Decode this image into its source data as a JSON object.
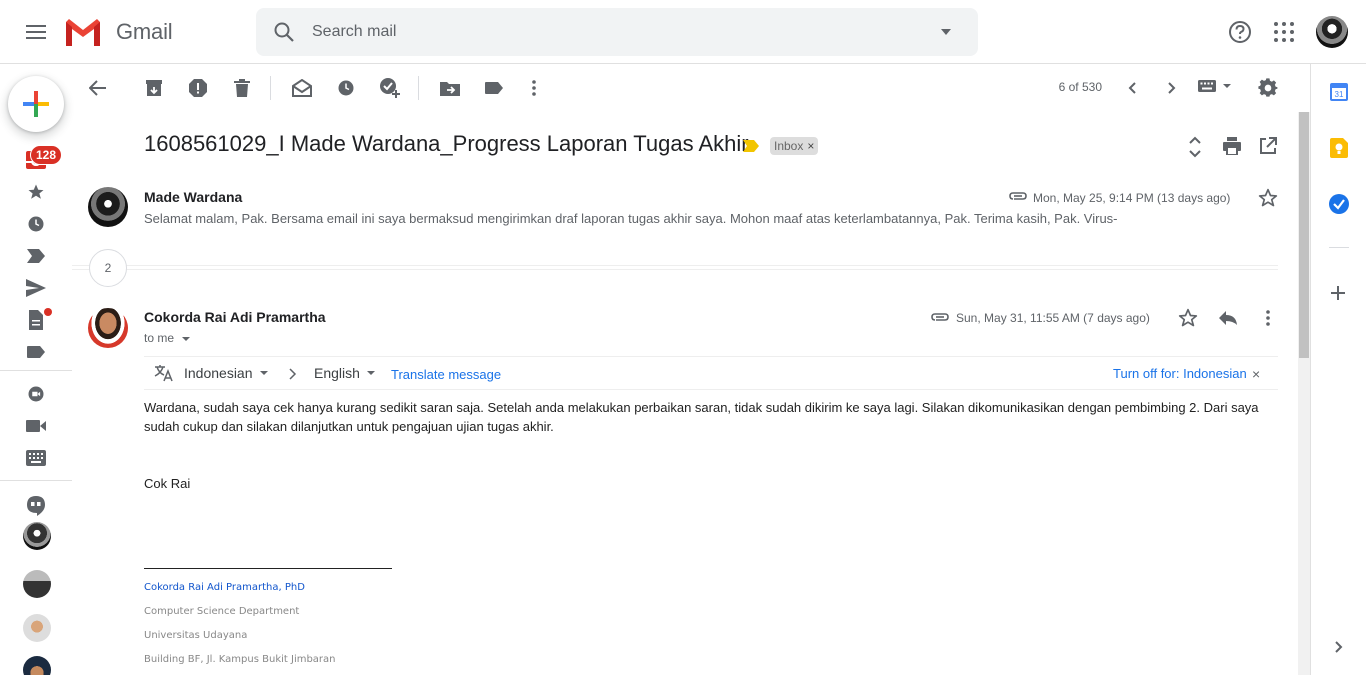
{
  "header": {
    "app_name": "Gmail",
    "search_placeholder": "Search mail"
  },
  "rail": {
    "inbox_badge": "128"
  },
  "toolbar": {
    "pager": "6 of 530"
  },
  "thread": {
    "subject": "1608561029_I Made Wardana_Progress Laporan Tugas Akhir",
    "label": "Inbox",
    "label_close": "×",
    "collapsed_count": "2"
  },
  "messages": [
    {
      "sender": "Made Wardana",
      "date": "Mon, May 25, 9:14 PM (13 days ago)",
      "snippet": "Selamat malam, Pak. Bersama email ini saya bermaksud mengirimkan draf laporan tugas akhir saya. Mohon maaf atas keterlambatannya, Pak. Terima kasih, Pak. Virus-"
    },
    {
      "sender": "Cokorda Rai Adi Pramartha",
      "date": "Sun, May 31, 11:55 AM (7 days ago)",
      "to": "to me",
      "body": "Wardana, sudah saya cek hanya kurang sedikit saran saja.  Setelah anda melakukan perbaikan saran, tidak sudah dikirim ke saya lagi.  Silakan dikomunikasikan dengan pembimbing 2.  Dari saya sudah cukup dan silakan dilanjutkan untuk pengajuan ujian tugas akhir.",
      "signoff": "Cok Rai",
      "signature": [
        "Cokorda Rai Adi Pramartha, PhD",
        "Computer Science Department",
        "Universitas Udayana",
        "Building BF, Jl. Kampus Bukit Jimbaran"
      ]
    }
  ],
  "translate": {
    "from": "Indonesian",
    "to": "English",
    "action": "Translate message",
    "turn_off": "Turn off for: Indonesian",
    "close": "×"
  },
  "colors": {
    "accent": "#1a73e8",
    "badge": "#d93025",
    "signature_name": "#1155cc",
    "signature_text": "#888888"
  }
}
